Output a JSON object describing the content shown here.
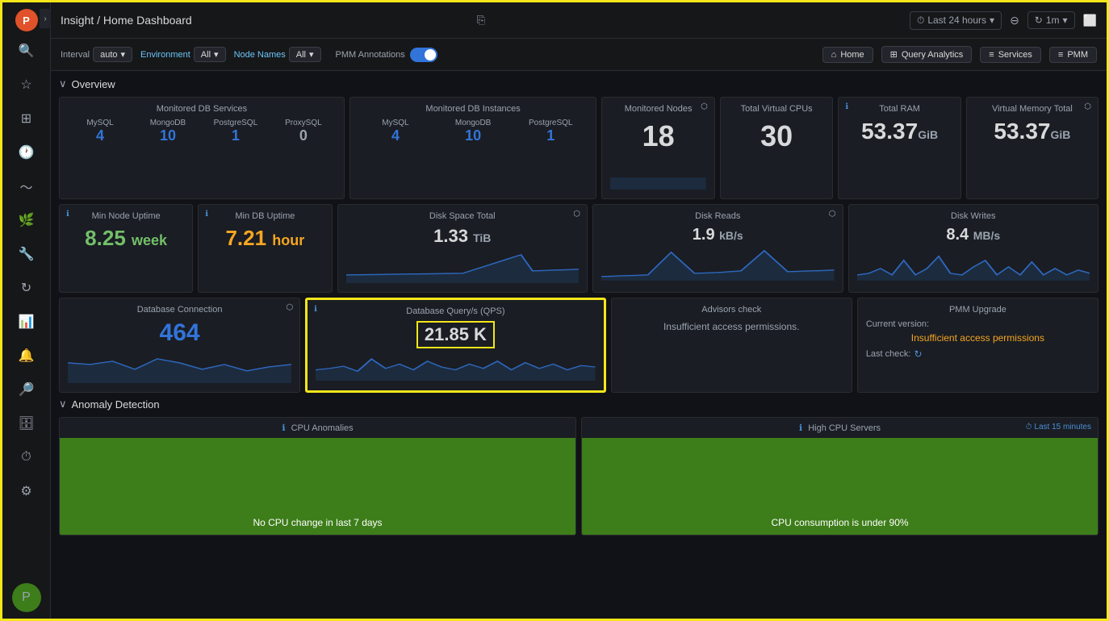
{
  "app": {
    "logo": "P",
    "title": "Insight / Home Dashboard",
    "share_icon": "share",
    "last_time": "Last 24 hours",
    "interval_label": "1m",
    "screen_icon": "⬜"
  },
  "toolbar": {
    "interval_label": "Interval",
    "interval_value": "auto",
    "environment_label": "Environment",
    "environment_value": "All",
    "node_names_label": "Node Names",
    "node_names_value": "All",
    "pmm_annotations_label": "PMM Annotations",
    "home_label": "Home",
    "query_analytics_label": "Query Analytics",
    "services_label": "Services",
    "pmm_label": "PMM"
  },
  "sidebar": {
    "icons": [
      "search",
      "star",
      "grid",
      "clock",
      "wave",
      "leaf",
      "wrench",
      "cycle",
      "chart",
      "settings",
      "user",
      "bell",
      "zoom",
      "db",
      "history",
      "gear"
    ]
  },
  "overview": {
    "title": "Overview",
    "db_services": {
      "title": "Monitored DB Services",
      "columns": [
        {
          "label": "MySQL",
          "value": "4"
        },
        {
          "label": "MongoDB",
          "value": "10"
        },
        {
          "label": "PostgreSQL",
          "value": "1"
        },
        {
          "label": "ProxySQL",
          "value": "0"
        }
      ]
    },
    "db_instances": {
      "title": "Monitored DB Instances",
      "columns": [
        {
          "label": "MySQL",
          "value": "4"
        },
        {
          "label": "MongoDB",
          "value": "10"
        },
        {
          "label": "PostgreSQL",
          "value": "1"
        }
      ]
    },
    "monitored_nodes": {
      "title": "Monitored Nodes",
      "value": "18"
    },
    "total_vcpus": {
      "title": "Total Virtual CPUs",
      "value": "30"
    },
    "total_ram": {
      "title": "Total RAM",
      "value": "53.37",
      "unit": "GiB"
    },
    "virtual_memory": {
      "title": "Virtual Memory Total",
      "value": "53.37",
      "unit": "GiB"
    },
    "min_node_uptime": {
      "title": "Min Node Uptime",
      "value": "8.25",
      "unit": "week"
    },
    "min_db_uptime": {
      "title": "Min DB Uptime",
      "value": "7.21",
      "unit": "hour"
    },
    "disk_space": {
      "title": "Disk Space Total",
      "value": "1.33",
      "unit": "TiB"
    },
    "disk_reads": {
      "title": "Disk Reads",
      "value": "1.9",
      "unit": "kB/s"
    },
    "disk_writes": {
      "title": "Disk Writes",
      "value": "8.4",
      "unit": "MB/s"
    },
    "db_connection": {
      "title": "Database Connection",
      "value": "464"
    },
    "db_qps": {
      "title": "Database Query/s (QPS)",
      "value": "21.85 K"
    },
    "advisors": {
      "title": "Advisors check",
      "message": "Insufficient access permissions."
    },
    "pmm_upgrade": {
      "title": "PMM Upgrade",
      "current_version_label": "Current version:",
      "message": "Insufficient access permissions",
      "last_check_label": "Last check:"
    }
  },
  "anomaly": {
    "title": "Anomaly Detection",
    "cpu_anomalies": {
      "title": "CPU Anomalies",
      "message": "No CPU change in last 7 days"
    },
    "high_cpu": {
      "title": "High CPU Servers",
      "message": "CPU consumption is under 90%",
      "badge": "Last 15 minutes"
    }
  }
}
